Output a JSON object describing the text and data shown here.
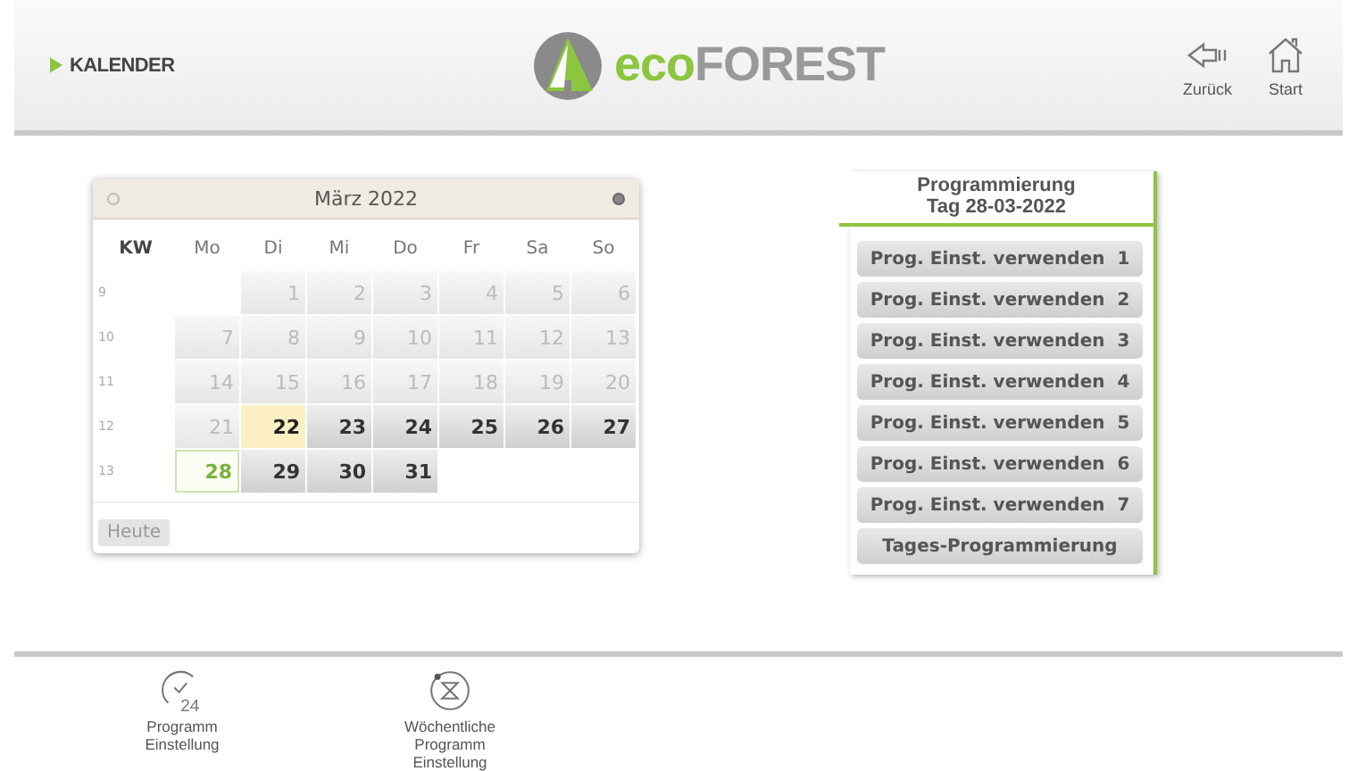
{
  "header": {
    "section": "KALENDER",
    "logo_prefix": "eco",
    "logo_suffix": "FOREST",
    "nav": [
      {
        "kind": "back",
        "label": "Zurück"
      },
      {
        "kind": "home",
        "label": "Start"
      }
    ]
  },
  "calendar": {
    "month": "März 2022",
    "week_heading": "KW",
    "weekdays": [
      "Mo",
      "Di",
      "Mi",
      "Do",
      "Fr",
      "Sa",
      "So"
    ],
    "weeks": [
      {
        "number": "9",
        "days": [
          {
            "label": "1",
            "disabled": true,
            "today": false,
            "selected": false
          },
          {
            "label": "2",
            "disabled": true,
            "today": false,
            "selected": false
          },
          {
            "label": "3",
            "disabled": true,
            "today": false,
            "selected": false
          },
          {
            "label": "4",
            "disabled": true,
            "today": false,
            "selected": false
          },
          {
            "label": "5",
            "disabled": true,
            "today": false,
            "selected": false
          },
          {
            "label": "6",
            "disabled": true,
            "today": false,
            "selected": false
          }
        ]
      },
      {
        "number": "10",
        "days": [
          {
            "label": "7",
            "disabled": true,
            "today": false,
            "selected": false
          },
          {
            "label": "8",
            "disabled": true,
            "today": false,
            "selected": false
          },
          {
            "label": "9",
            "disabled": true,
            "today": false,
            "selected": false
          },
          {
            "label": "10",
            "disabled": true,
            "today": false,
            "selected": false
          },
          {
            "label": "11",
            "disabled": true,
            "today": false,
            "selected": false
          },
          {
            "label": "12",
            "disabled": true,
            "today": false,
            "selected": false
          },
          {
            "label": "13",
            "disabled": true,
            "today": false,
            "selected": false
          }
        ]
      },
      {
        "number": "11",
        "days": [
          {
            "label": "14",
            "disabled": true,
            "today": false,
            "selected": false
          },
          {
            "label": "15",
            "disabled": true,
            "today": false,
            "selected": false
          },
          {
            "label": "16",
            "disabled": true,
            "today": false,
            "selected": false
          },
          {
            "label": "17",
            "disabled": true,
            "today": false,
            "selected": false
          },
          {
            "label": "18",
            "disabled": true,
            "today": false,
            "selected": false
          },
          {
            "label": "19",
            "disabled": true,
            "today": false,
            "selected": false
          },
          {
            "label": "20",
            "disabled": true,
            "today": false,
            "selected": false
          }
        ]
      },
      {
        "number": "12",
        "days": [
          {
            "label": "21",
            "disabled": true,
            "today": false,
            "selected": false
          },
          {
            "label": "22",
            "disabled": false,
            "today": true,
            "selected": false
          },
          {
            "label": "23",
            "disabled": false,
            "today": false,
            "selected": false
          },
          {
            "label": "24",
            "disabled": false,
            "today": false,
            "selected": false
          },
          {
            "label": "25",
            "disabled": false,
            "today": false,
            "selected": false
          },
          {
            "label": "26",
            "disabled": false,
            "today": false,
            "selected": false
          },
          {
            "label": "27",
            "disabled": false,
            "today": false,
            "selected": false
          }
        ]
      },
      {
        "number": "13",
        "days": [
          {
            "label": "28",
            "disabled": false,
            "today": false,
            "selected": true
          },
          {
            "label": "29",
            "disabled": false,
            "today": false,
            "selected": false
          },
          {
            "label": "30",
            "disabled": false,
            "today": false,
            "selected": false
          },
          {
            "label": "31",
            "disabled": false,
            "today": false,
            "selected": false
          }
        ]
      }
    ],
    "today_button": "Heute"
  },
  "program": {
    "title": "Programmierung",
    "date": "Tag 28-03-2022",
    "buttons": [
      "Prog. Einst. verwenden  1",
      "Prog. Einst. verwenden  2",
      "Prog. Einst. verwenden  3",
      "Prog. Einst. verwenden  4",
      "Prog. Einst. verwenden  5",
      "Prog. Einst. verwenden  6",
      "Prog. Einst. verwenden  7",
      "Tages-Programmierung"
    ]
  },
  "footer": [
    {
      "kind": "daily",
      "icon_text": "24",
      "label": "Programm Einstellung"
    },
    {
      "kind": "weekly",
      "label": "Wöchentliche Programm Einstellung"
    }
  ]
}
